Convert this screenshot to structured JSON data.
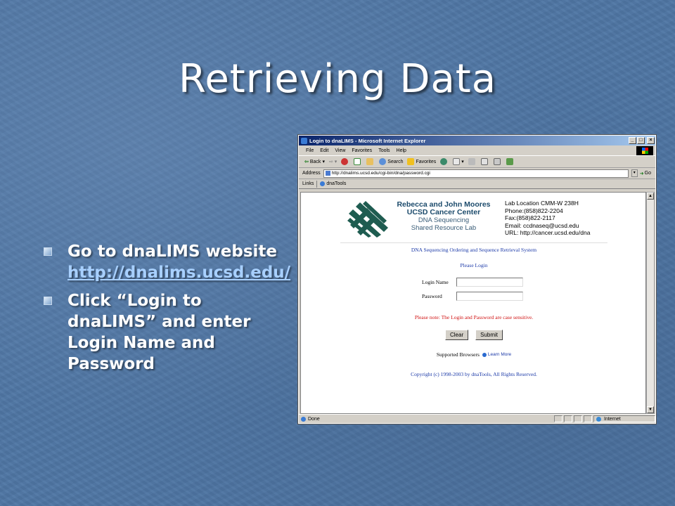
{
  "slide": {
    "title": "Retrieving Data",
    "bullets": [
      {
        "text": "Go to dnaLIMS website",
        "link": "http://dnalims.ucsd.edu/"
      },
      {
        "text": "Click “Login to dnaLIMS” and enter Login Name and Password"
      }
    ]
  },
  "browser": {
    "window_title": "Login to dnaLIMS - Microsoft Internet Explorer",
    "menu": [
      "File",
      "Edit",
      "View",
      "Favorites",
      "Tools",
      "Help"
    ],
    "toolbar": {
      "back": "Back",
      "search": "Search",
      "favorites": "Favorites"
    },
    "address_label": "Address",
    "address_value": "http://dnalims.ucsd.edu/cgi-bin/dna/password.cgi",
    "go_label": "Go",
    "links_label": "Links",
    "links_item": "dnaTools",
    "status": {
      "text": "Done",
      "zone": "Internet"
    }
  },
  "page": {
    "org_lines": [
      "Rebecca and John Moores",
      "UCSD Cancer Center"
    ],
    "org_sub": [
      "DNA Sequencing",
      "Shared Resource Lab"
    ],
    "lab_info": [
      "Lab Location CMM-W 238H",
      "Phone:(858)822-2204",
      "Fax:(858)822-2117",
      "Email: ccdnaseq@ucsd.edu",
      "URL: http://cancer.ucsd.edu/dna"
    ],
    "system_name": "DNA Sequencing Ordering and Sequence Retrieval System",
    "please_login": "Please Login",
    "login_label": "Login Name",
    "password_label": "Password",
    "note": "Please note: The Login and Password are case sensitive.",
    "clear_label": "Clear",
    "submit_label": "Submit",
    "supported_label": "Supported Browsers",
    "learn_more": "Learn More",
    "copyright": "Copyright (c) 1998-2003 by dnaTools, All Rights Reserved."
  },
  "colors": {
    "slide_bg": "#4f76a4",
    "titlebar": "#0a246a",
    "page_link": "#1c3aa8",
    "warning": "#d01010",
    "logo": "#1e5c50"
  }
}
